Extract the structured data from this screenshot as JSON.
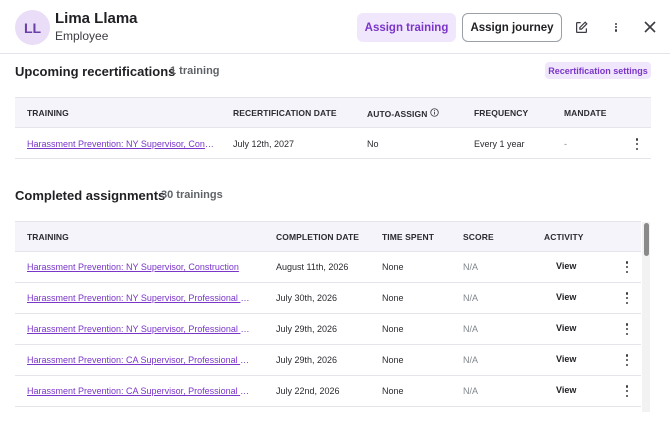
{
  "header": {
    "avatar_initials": "LL",
    "name": "Lima Llama",
    "role": "Employee",
    "assign_training_label": "Assign training",
    "assign_journey_label": "Assign journey"
  },
  "recertifications": {
    "title": "Upcoming recertifications",
    "count": "1 training",
    "settings_label": "Recertification settings",
    "columns": [
      "TRAINING",
      "RECERTIFICATION DATE",
      "AUTO-ASSIGN",
      "FREQUENCY",
      "MANDATE"
    ],
    "rows": [
      {
        "training": "Harassment Prevention: NY Supervisor, Cons...",
        "date": "July 12th, 2027",
        "auto_assign": "No",
        "frequency": "Every 1 year",
        "mandate": "-"
      }
    ]
  },
  "completed": {
    "title": "Completed assignments",
    "count": "30 trainings",
    "columns": [
      "TRAINING",
      "COMPLETION DATE",
      "TIME SPENT",
      "SCORE",
      "ACTIVITY"
    ],
    "rows": [
      {
        "training": "Harassment Prevention: NY Supervisor, Construction",
        "date": "August 11th, 2026",
        "time": "None",
        "score": "N/A",
        "activity": "View"
      },
      {
        "training": "Harassment Prevention: NY Supervisor, Professional Se...",
        "date": "July 30th, 2026",
        "time": "None",
        "score": "N/A",
        "activity": "View"
      },
      {
        "training": "Harassment Prevention: NY Supervisor, Professional Se...",
        "date": "July 29th, 2026",
        "time": "None",
        "score": "N/A",
        "activity": "View"
      },
      {
        "training": "Harassment Prevention: CA Supervisor, Professional Se...",
        "date": "July 29th, 2026",
        "time": "None",
        "score": "N/A",
        "activity": "View"
      },
      {
        "training": "Harassment Prevention: CA Supervisor, Professional Se...",
        "date": "July 22nd, 2026",
        "time": "None",
        "score": "N/A",
        "activity": "View"
      }
    ]
  },
  "colors": {
    "accent": "#7a35c9",
    "accent_bg": "#f1e7fd",
    "header_bg": "#f6f4fb"
  },
  "icons": [
    "edit-icon",
    "more-vertical-icon",
    "close-icon",
    "info-icon"
  ]
}
